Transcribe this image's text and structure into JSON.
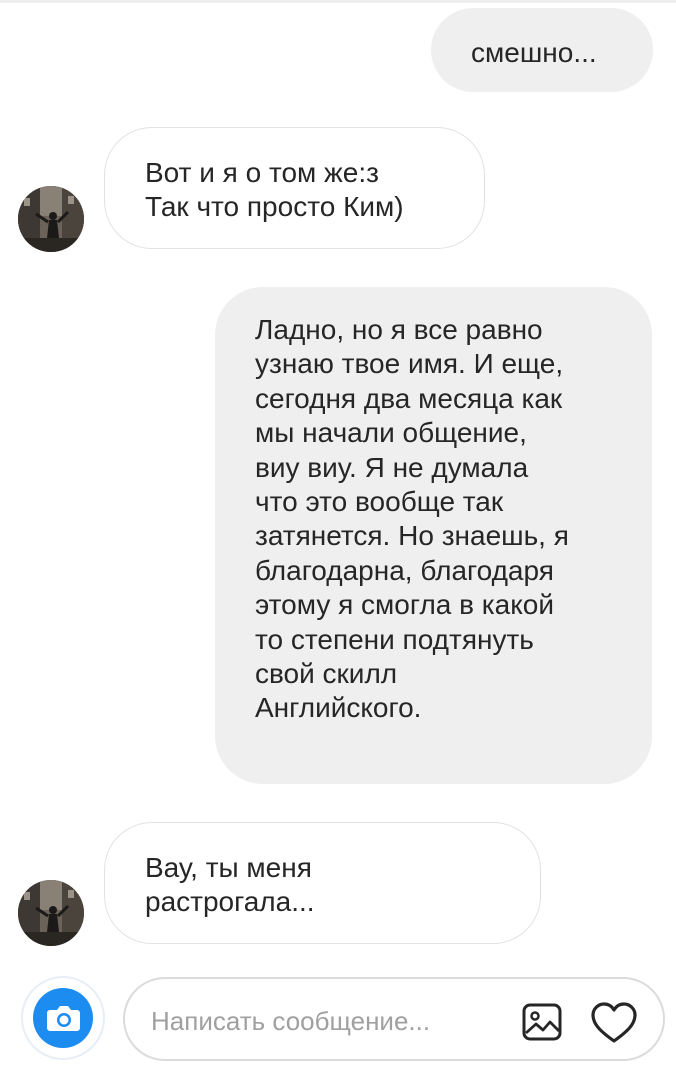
{
  "messages": [
    {
      "id": "msg1",
      "direction": "outgoing",
      "text": "смешно..."
    },
    {
      "id": "msg2",
      "direction": "incoming",
      "text": "Вот и я о том же:з\nТак что просто Ким)"
    },
    {
      "id": "msg3",
      "direction": "outgoing",
      "text": "Ладно, но я все равно\nузнаю твое имя. И еще,\nсегодня два месяца как\nмы начали общение,\nвиу виу. Я не думала\nчто это вообще так\nзатянется. Но знаешь, я\nблагодарна, благодаря\nэтому я смогла в какой\nто степени подтянуть\nсвой скилл\nАнглийского."
    },
    {
      "id": "msg4",
      "direction": "incoming",
      "text": "Вау, ты меня\nрастрогала..."
    }
  ],
  "composer": {
    "placeholder": "Написать сообщение...",
    "value": ""
  },
  "icons": {
    "camera": "camera-icon",
    "gallery": "image-icon",
    "like": "heart-icon",
    "avatar": "contact-avatar"
  },
  "colors": {
    "outgoing_bubble": "#efefef",
    "incoming_border": "#e2e2e2",
    "camera_accent": "#1d8cf0",
    "text": "#262626",
    "placeholder": "#a0a0a0"
  }
}
